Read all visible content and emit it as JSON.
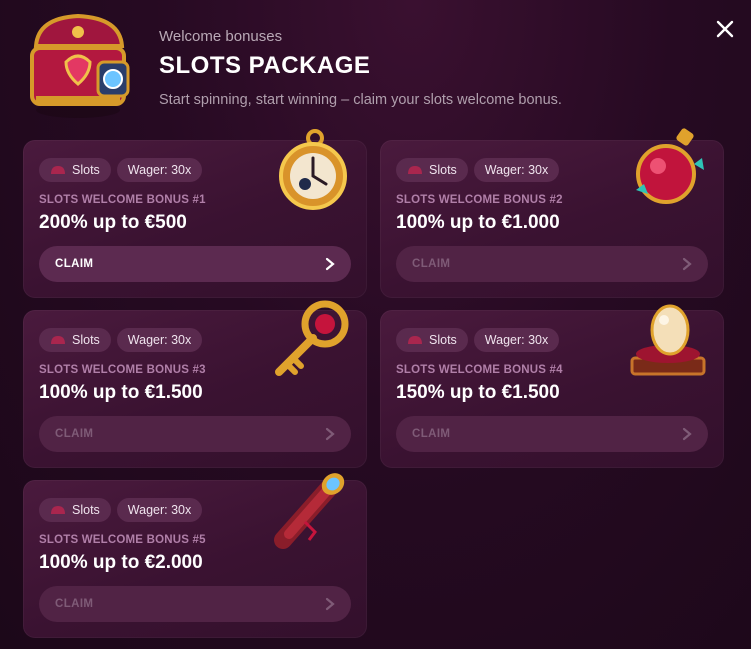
{
  "header": {
    "subtitle": "Welcome bonuses",
    "title": "SLOTS PACKAGE",
    "description": "Start spinning, start winning – claim your slots welcome bonus."
  },
  "cards": [
    {
      "category": "Slots",
      "wager": "Wager: 30x",
      "label": "SLOTS WELCOME BONUS #1",
      "amount": "200% up to €500",
      "claim": "CLAIM",
      "claim_enabled": true,
      "art": "pocket-watch-icon"
    },
    {
      "category": "Slots",
      "wager": "Wager: 30x",
      "label": "SLOTS WELCOME BONUS #2",
      "amount": "100% up to €1.000",
      "claim": "CLAIM",
      "claim_enabled": false,
      "art": "potion-flask-icon"
    },
    {
      "category": "Slots",
      "wager": "Wager: 30x",
      "label": "SLOTS WELCOME BONUS #3",
      "amount": "100% up to €1.500",
      "claim": "CLAIM",
      "claim_enabled": false,
      "art": "golden-key-icon"
    },
    {
      "category": "Slots",
      "wager": "Wager: 30x",
      "label": "SLOTS WELCOME BONUS #4",
      "amount": "150% up to €1.500",
      "claim": "CLAIM",
      "claim_enabled": false,
      "art": "golden-egg-icon"
    },
    {
      "category": "Slots",
      "wager": "Wager: 30x",
      "label": "SLOTS WELCOME BONUS #5",
      "amount": "100% up to €2.000",
      "claim": "CLAIM",
      "claim_enabled": false,
      "art": "spyglass-icon"
    }
  ],
  "icons": {
    "close": "close-icon",
    "header": "treasure-chest-icon",
    "slots": "slots-icon",
    "chevron": "chevron-right-icon"
  },
  "colors": {
    "background": "#260a22",
    "card": "#3a1231",
    "badge": "#5a2a4e",
    "label": "#b07fa8",
    "claim_active_text": "#ffffff",
    "claim_disabled_text": "#7f5b77"
  }
}
